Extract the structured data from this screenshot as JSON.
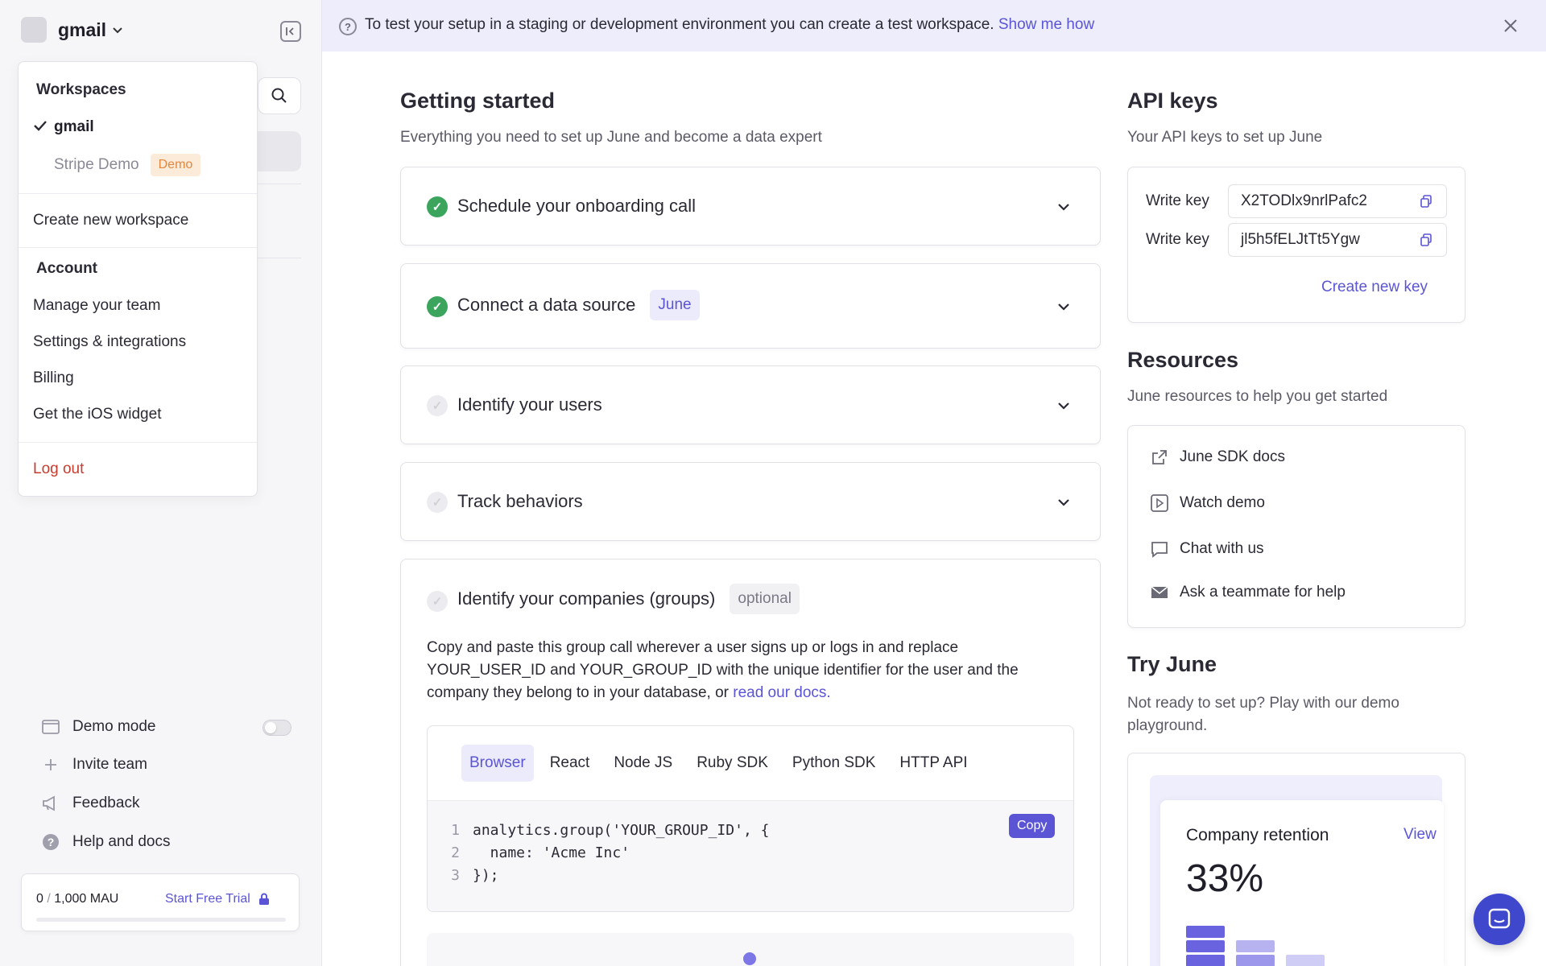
{
  "workspace": {
    "name": "gmail"
  },
  "dropdown": {
    "workspaces_title": "Workspaces",
    "workspaces": [
      {
        "name": "gmail",
        "active": true
      },
      {
        "name": "Stripe Demo",
        "badge": "Demo"
      }
    ],
    "create_workspace": "Create new workspace",
    "account_title": "Account",
    "account_items": [
      "Manage your team",
      "Settings & integrations",
      "Billing",
      "Get the iOS widget"
    ],
    "logout": "Log out"
  },
  "sidebar_bottom": {
    "demo_mode": "Demo mode",
    "demo_mode_on": false,
    "invite": "Invite team",
    "feedback": "Feedback",
    "help": "Help and docs",
    "mau_used": "0",
    "mau_sep": "/",
    "mau_limit": "1,000 MAU",
    "trial": "Start Free Trial"
  },
  "banner": {
    "text": "To test your setup in a staging or development environment you can create a test workspace.",
    "link": "Show me how"
  },
  "getting_started": {
    "title": "Getting started",
    "subtitle": "Everything you need to set up June and become a data expert",
    "steps": [
      {
        "title": "Schedule your onboarding call",
        "done": true
      },
      {
        "title": "Connect a data source",
        "done": true,
        "tag": "June"
      },
      {
        "title": "Identify your users",
        "done": false
      },
      {
        "title": "Track behaviors",
        "done": false
      },
      {
        "title": "Identify your companies (groups)",
        "done": false,
        "tag": "optional"
      }
    ],
    "groups_text": "Copy and paste this group call wherever a user signs up or logs in and replace YOUR_USER_ID and YOUR_GROUP_ID with the unique identifier for the user and the company they belong to in your database, or",
    "groups_link": "read our docs.",
    "tabs": [
      "Browser",
      "React",
      "Node JS",
      "Ruby SDK",
      "Python SDK",
      "HTTP API"
    ],
    "active_tab": "Browser",
    "copy_label": "Copy",
    "code_lines": [
      {
        "n": "1",
        "text": "analytics.group('YOUR_GROUP_ID', {"
      },
      {
        "n": "2",
        "text": "  name: 'Acme Inc'"
      },
      {
        "n": "3",
        "text": "});"
      }
    ]
  },
  "api_keys": {
    "title": "API keys",
    "subtitle": "Your API keys to set up June",
    "keys": [
      {
        "label": "Write key",
        "value": "X2TODlx9nrlPafc2"
      },
      {
        "label": "Write key",
        "value": "jl5h5fELJtTt5Ygw"
      }
    ],
    "create": "Create new key"
  },
  "resources": {
    "title": "Resources",
    "subtitle": "June resources to help you get started",
    "items": [
      {
        "label": "June SDK docs",
        "icon": "external-link-icon"
      },
      {
        "label": "Watch demo",
        "icon": "play-icon"
      },
      {
        "label": "Chat with us",
        "icon": "chat-icon"
      },
      {
        "label": "Ask a teammate for help",
        "icon": "mail-icon"
      }
    ]
  },
  "try_june": {
    "title": "Try June",
    "subtitle": "Not ready to set up? Play with our demo playground.",
    "preview_title": "Company retention",
    "preview_view": "View",
    "preview_value": "33%"
  },
  "colors": {
    "accent": "#5b55d6",
    "success": "#3ba55d",
    "danger": "#c63d2f",
    "banner_bg": "#ededfb"
  }
}
